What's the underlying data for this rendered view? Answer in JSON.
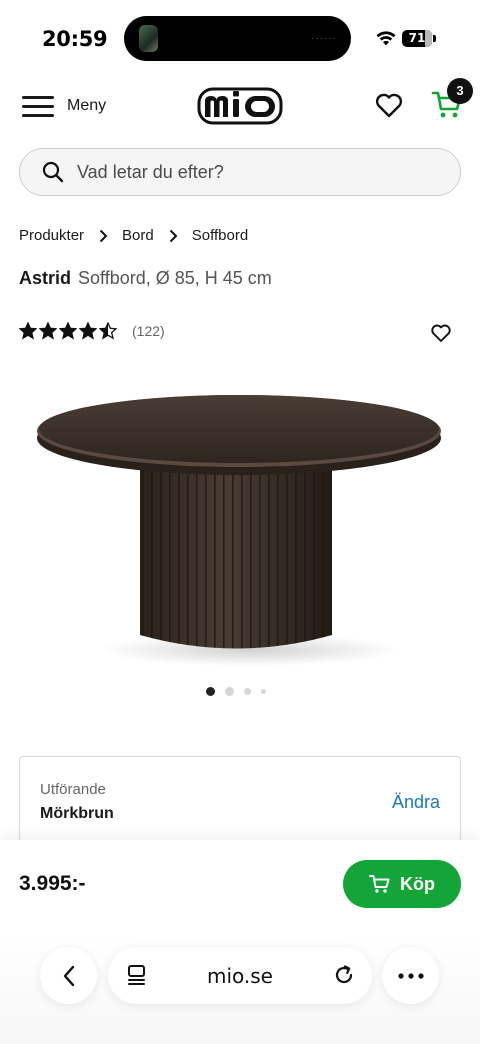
{
  "status_bar": {
    "time": "20:59",
    "battery": "71"
  },
  "header": {
    "menu_label": "Meny",
    "cart_count": "3"
  },
  "search": {
    "placeholder": "Vad letar du efter?"
  },
  "breadcrumb": [
    "Produkter",
    "Bord",
    "Soffbord"
  ],
  "product": {
    "name": "Astrid",
    "description": "Soffbord, Ø 85, H 45 cm",
    "rating": 4.5,
    "review_count": "(122)"
  },
  "carousel": {
    "slides": 4,
    "active": 1
  },
  "variant": {
    "label": "Utförande",
    "value": "Mörkbrun",
    "change_label": "Ändra"
  },
  "buy": {
    "price": "3.995:-",
    "button_label": "Köp"
  },
  "browser": {
    "url": "mio.se"
  },
  "colors": {
    "accent_green": "#13a538",
    "link_blue": "#1a7ab8"
  }
}
